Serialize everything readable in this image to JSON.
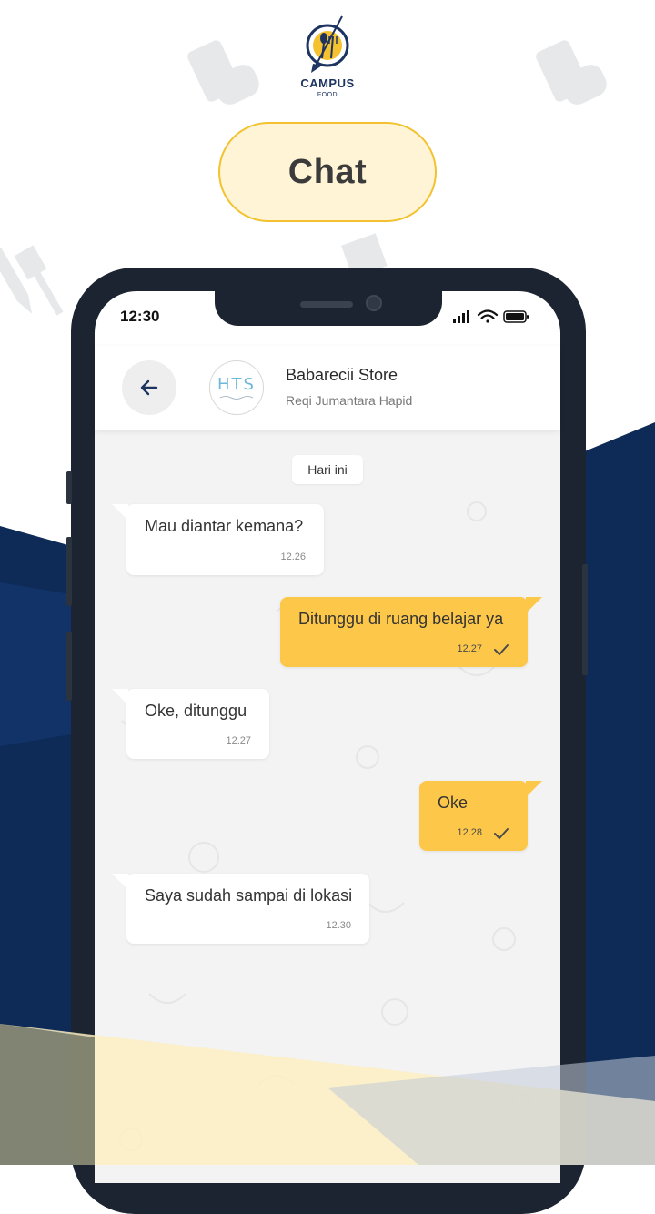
{
  "app": {
    "logo_text": "CAMPUS",
    "logo_sub": "FOOD",
    "page_title": "Chat"
  },
  "status_bar": {
    "time": "12:30"
  },
  "chat_header": {
    "avatar_text": "HTS",
    "store_name": "Babarecii Store",
    "user_name": "Reqi Jumantara Hapid"
  },
  "chat": {
    "date_label": "Hari ini",
    "messages": [
      {
        "direction": "in",
        "text": "Mau diantar kemana?",
        "time": "12.26"
      },
      {
        "direction": "out",
        "text": "Ditunggu di ruang belajar ya",
        "time": "12.27"
      },
      {
        "direction": "in",
        "text": "Oke, ditunggu",
        "time": "12.27"
      },
      {
        "direction": "out",
        "text": "Oke",
        "time": "12.28"
      },
      {
        "direction": "in",
        "text": "Saya sudah sampai di lokasi",
        "time": "12.30"
      }
    ]
  },
  "colors": {
    "navy": "#0e2a56",
    "accent_yellow": "#fdc84a",
    "pill_border": "#f2c230",
    "pill_fill": "#fff4d6"
  }
}
